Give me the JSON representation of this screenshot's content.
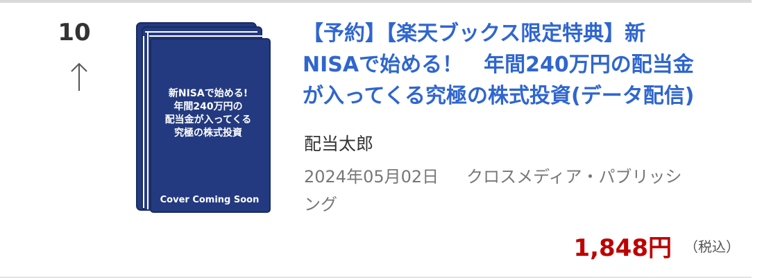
{
  "rank": "10",
  "trend_icon": "up-arrow-icon",
  "cover": {
    "lines": [
      "新NISAで始める!",
      "年間240万円の",
      "配当金が入ってくる",
      "究極の株式投資"
    ],
    "footer": "Cover Coming Soon",
    "color": "#233a80"
  },
  "title_lines": [
    "【予約】【楽天ブックス限定特典】新",
    "NISAで始める！　年間240万円の配当金",
    "が入ってくる究極の株式投資(データ配信)"
  ],
  "author": "配当太郎",
  "release_date": "2024年05月02日",
  "publisher_lines": [
    "クロスメディア・パブリッシ",
    "ング"
  ],
  "price": "1,848円",
  "tax_label": "（税込）",
  "colors": {
    "title_link": "#2f66cf",
    "price": "#bf0000",
    "divider": "#d9d9d9"
  }
}
